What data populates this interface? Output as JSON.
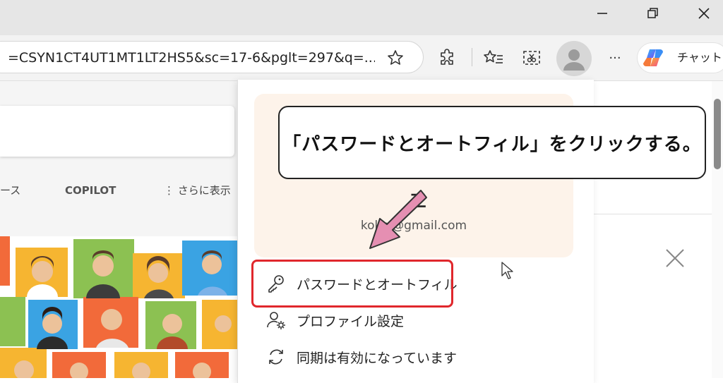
{
  "window": {
    "minimize_icon": "minimize-icon",
    "restore_icon": "restore-icon",
    "close_icon": "close-icon"
  },
  "toolbar": {
    "url": "=CSYN1CT4UT1MT1LT2HS5&sc=17-6&pglt=297&q=...",
    "icons": [
      "star-icon",
      "extensions-icon",
      "favorites-icon",
      "screenshot-icon",
      "avatar",
      "more-icon",
      "copilot-icon"
    ],
    "more_label": "···",
    "chat_label": "チャット"
  },
  "page": {
    "tabs": [
      {
        "label": "ース"
      },
      {
        "label": "COPILOT"
      },
      {
        "label": "⋮ さらに表示"
      }
    ]
  },
  "flyout": {
    "name_fragment": "三",
    "email": "kokc        @gmail.com",
    "menu": [
      {
        "label": "パスワードとオートフィル",
        "icon": "key-icon"
      },
      {
        "label": "プロファイル設定",
        "icon": "profile-settings-icon"
      },
      {
        "label": "同期は有効になっています",
        "icon": "sync-icon"
      }
    ]
  },
  "callout": {
    "text": "「パスワードとオートフィル」をクリックする。"
  },
  "colors": {
    "highlight": "#e0272c",
    "arrow": "#e58fb2",
    "profile_card": "#fdf3ea"
  }
}
